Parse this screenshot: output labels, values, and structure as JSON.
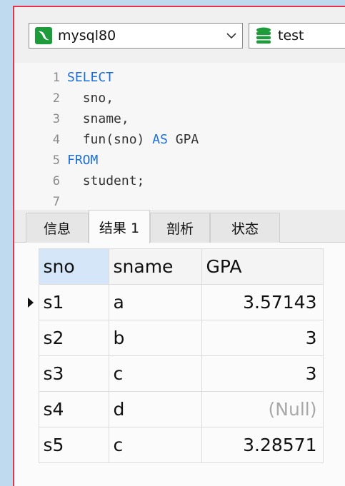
{
  "toolbar": {
    "connection": {
      "label": "mysql80",
      "icon": "mysql-dolphin-icon",
      "icon_color": "#1e9b3a"
    },
    "database": {
      "label": "test",
      "icon": "database-icon",
      "icon_color": "#1e9b3a"
    }
  },
  "editor": {
    "lines": [
      {
        "num": "1",
        "indent": "",
        "parts": [
          {
            "t": "SELECT",
            "kw": true
          }
        ]
      },
      {
        "num": "2",
        "indent": "  ",
        "parts": [
          {
            "t": "sno,",
            "kw": false
          }
        ]
      },
      {
        "num": "3",
        "indent": "  ",
        "parts": [
          {
            "t": "sname,",
            "kw": false
          }
        ]
      },
      {
        "num": "4",
        "indent": "  ",
        "parts": [
          {
            "t": "fun(sno) ",
            "kw": false
          },
          {
            "t": "AS",
            "kw": true
          },
          {
            "t": " GPA",
            "kw": false
          }
        ]
      },
      {
        "num": "5",
        "indent": "",
        "parts": [
          {
            "t": "FROM",
            "kw": true
          }
        ]
      },
      {
        "num": "6",
        "indent": "  ",
        "parts": [
          {
            "t": "student;",
            "kw": false
          }
        ]
      },
      {
        "num": "7",
        "indent": "",
        "parts": []
      }
    ],
    "keyword_color": "#1c6fd8"
  },
  "tabs": [
    {
      "label": "信息",
      "active": false
    },
    {
      "label": "结果 1",
      "active": true
    },
    {
      "label": "剖析",
      "active": false
    },
    {
      "label": "状态",
      "active": false
    }
  ],
  "grid": {
    "columns": [
      "sno",
      "sname",
      "GPA"
    ],
    "rows": [
      {
        "sno": "s1",
        "sname": "a",
        "gpa": "3.57143",
        "current": true
      },
      {
        "sno": "s2",
        "sname": "b",
        "gpa": "3",
        "current": false
      },
      {
        "sno": "s3",
        "sname": "c",
        "gpa": "3",
        "current": false
      },
      {
        "sno": "s4",
        "sname": "d",
        "gpa": "(Null)",
        "current": false
      },
      {
        "sno": "s5",
        "sname": "c",
        "gpa": "3.28571",
        "current": false
      }
    ]
  }
}
